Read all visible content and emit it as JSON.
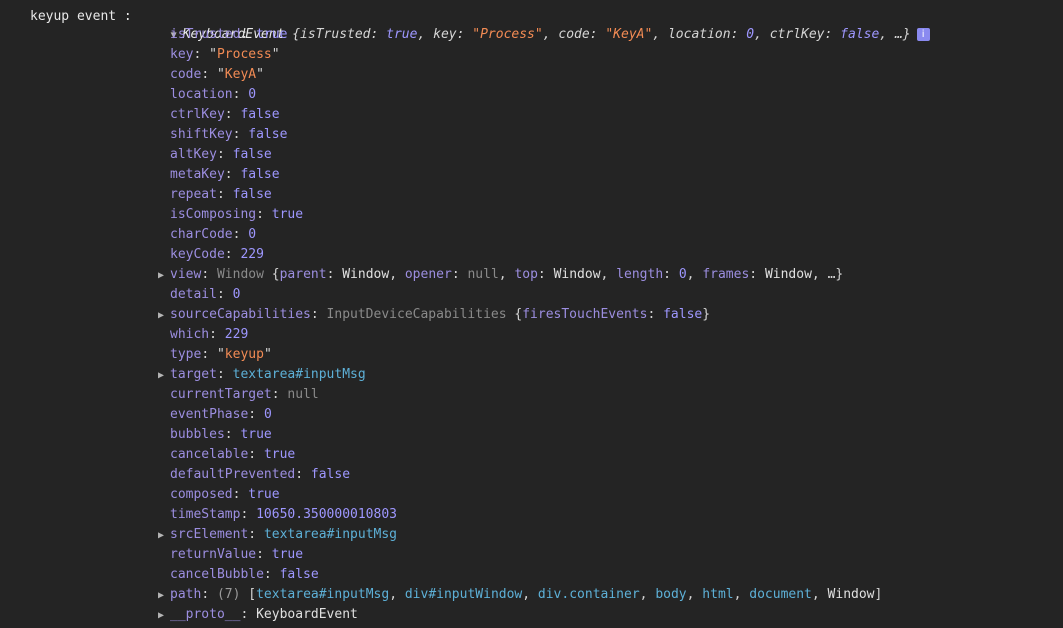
{
  "prefix": "keyup event : ",
  "summary": {
    "ctor": "KeyboardEvent",
    "text_parts": [
      "{isTrusted: ",
      "true",
      ", key: ",
      "\"Process\"",
      ", code: ",
      "\"KeyA\"",
      ", location: ",
      "0",
      ", ctrlKey: ",
      "false",
      ", …}"
    ],
    "info_label": "i"
  },
  "props": [
    {
      "key": "isTrusted",
      "value": "true",
      "type": "bool"
    },
    {
      "key": "key",
      "value": "Process",
      "type": "str"
    },
    {
      "key": "code",
      "value": "KeyA",
      "type": "str"
    },
    {
      "key": "location",
      "value": "0",
      "type": "num"
    },
    {
      "key": "ctrlKey",
      "value": "false",
      "type": "bool"
    },
    {
      "key": "shiftKey",
      "value": "false",
      "type": "bool"
    },
    {
      "key": "altKey",
      "value": "false",
      "type": "bool"
    },
    {
      "key": "metaKey",
      "value": "false",
      "type": "bool"
    },
    {
      "key": "repeat",
      "value": "false",
      "type": "bool"
    },
    {
      "key": "isComposing",
      "value": "true",
      "type": "bool"
    },
    {
      "key": "charCode",
      "value": "0",
      "type": "num"
    },
    {
      "key": "keyCode",
      "value": "229",
      "type": "num"
    },
    {
      "key": "view",
      "type": "window"
    },
    {
      "key": "detail",
      "value": "0",
      "type": "num"
    },
    {
      "key": "sourceCapabilities",
      "type": "caps"
    },
    {
      "key": "which",
      "value": "229",
      "type": "num"
    },
    {
      "key": "type",
      "value": "keyup",
      "type": "str"
    },
    {
      "key": "target",
      "value_tag": "textarea",
      "value_id": "#inputMsg",
      "type": "node",
      "expandable": true
    },
    {
      "key": "currentTarget",
      "value": "null",
      "type": "null"
    },
    {
      "key": "eventPhase",
      "value": "0",
      "type": "num"
    },
    {
      "key": "bubbles",
      "value": "true",
      "type": "bool"
    },
    {
      "key": "cancelable",
      "value": "true",
      "type": "bool"
    },
    {
      "key": "defaultPrevented",
      "value": "false",
      "type": "bool"
    },
    {
      "key": "composed",
      "value": "true",
      "type": "bool"
    },
    {
      "key": "timeStamp",
      "value": "10650.350000010803",
      "type": "num"
    },
    {
      "key": "srcElement",
      "value_tag": "textarea",
      "value_id": "#inputMsg",
      "type": "node",
      "expandable": true
    },
    {
      "key": "returnValue",
      "value": "true",
      "type": "bool"
    },
    {
      "key": "cancelBubble",
      "value": "false",
      "type": "bool"
    },
    {
      "key": "path",
      "type": "path"
    },
    {
      "key": "__proto__",
      "value": "KeyboardEvent",
      "type": "plain",
      "expandable": true
    }
  ],
  "view_preview": {
    "cls": "Window",
    "parts": [
      {
        "k": "parent",
        "v": "Window",
        "t": "plain"
      },
      {
        "k": "opener",
        "v": "null",
        "t": "null"
      },
      {
        "k": "top",
        "v": "Window",
        "t": "plain"
      },
      {
        "k": "length",
        "v": "0",
        "t": "num"
      },
      {
        "k": "frames",
        "v": "Window",
        "t": "plain"
      }
    ],
    "ellipsis": "…"
  },
  "caps_preview": {
    "cls": "InputDeviceCapabilities",
    "k": "firesTouchEvents",
    "v": "false"
  },
  "path_preview": {
    "count": "(7)",
    "items": [
      {
        "tag": "textarea",
        "id": "#inputMsg",
        "t": "node"
      },
      {
        "tag": "div",
        "id": "#inputWindow",
        "t": "node"
      },
      {
        "tag": "div",
        "id": ".container",
        "t": "node"
      },
      {
        "tag": "body",
        "id": "",
        "t": "node"
      },
      {
        "tag": "html",
        "id": "",
        "t": "node"
      },
      {
        "tag": "document",
        "id": "",
        "t": "node"
      },
      {
        "tag": "Window",
        "id": "",
        "t": "plain"
      }
    ]
  },
  "colors": {
    "background": "#242424",
    "key": "#9c8ee0",
    "string": "#f28b54",
    "number_bool": "#9e97ff",
    "node": "#5db0d7"
  }
}
